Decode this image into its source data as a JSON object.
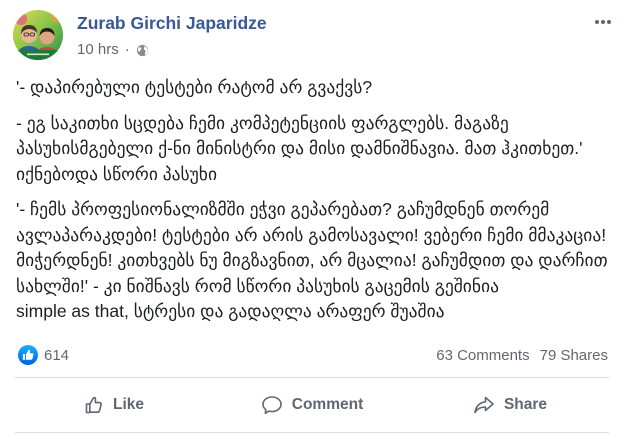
{
  "post": {
    "author": {
      "name": "Zurab Girchi Japaridze",
      "avatar": "profile-photo"
    },
    "timestamp": "10 hrs",
    "separator": "·",
    "audience_icon": "globe-icon",
    "menu_icon": "more-options-icon",
    "paragraphs": [
      [
        "'- დაპირებული ტესტები რატომ არ გვაქვს?"
      ],
      [
        "- ეგ საკითხი სცდება ჩემი კომპეტენციის ფარგლებს. მაგაზე",
        "პასუხისმგებელი ქ-ნი მინისტრი და მისი დამნიშნავია. მათ ჰკითხეთ.'",
        "იქნებოდა სწორი პასუხი"
      ],
      [
        "'- ჩემს პროფესიონალიზმში ეჭვი გეპარებათ? გაჩუმდნენ თორემ",
        "ავლაპარაკდები! ტესტები არ არის გამოსავალი! ვებერი ჩემი მმაკაცია!",
        "მიჭერდნენ! კითხვებს ნუ მიგზავნით, არ მცალია! გაჩუმდით და დარჩით",
        "სახლში!' - კი ნიშნავს რომ სწორი პასუხის გაცემის გეშინია",
        "simple as that, სტრესი და გადაღლა არაფერ შუაშია"
      ]
    ]
  },
  "engagement": {
    "reaction_icon": "like-reaction-icon",
    "reaction_count": "614",
    "comments": "63 Comments",
    "shares": "79 Shares"
  },
  "actions": [
    {
      "label": "Like",
      "icon": "thumbs-up-icon"
    },
    {
      "label": "Comment",
      "icon": "comment-icon"
    },
    {
      "label": "Share",
      "icon": "share-icon"
    }
  ],
  "theme": {
    "link": "#385898",
    "meta": "#616770",
    "text": "#1c1e21",
    "muted": "#606770",
    "divider": "#dadde1",
    "like_blue": "#1877f2"
  }
}
